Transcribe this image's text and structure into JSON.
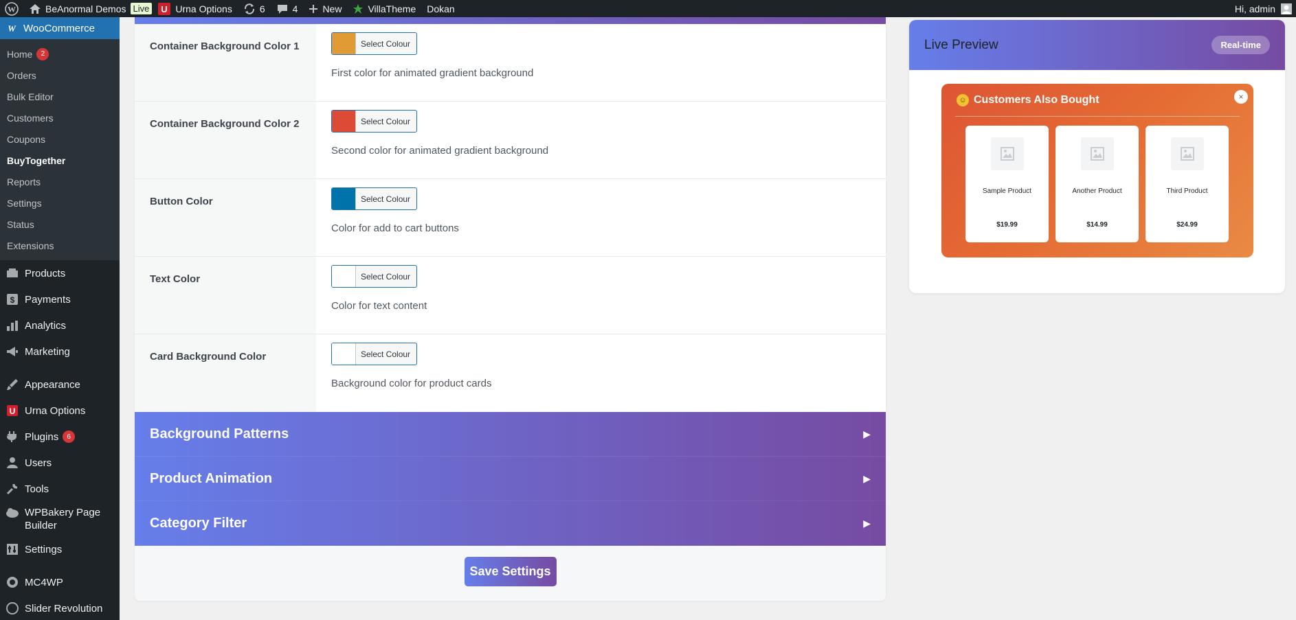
{
  "adminbar": {
    "site_name": "BeAnormal Demos",
    "live_label": "Live",
    "theme_options": "Urna Options",
    "updates_count": "6",
    "comments_count": "4",
    "new_label": "New",
    "villatheme": "VillaTheme",
    "dokan": "Dokan",
    "greeting": "Hi, admin"
  },
  "sidebar": {
    "woo_label": "WooCommerce",
    "submenu": [
      {
        "label": "Home",
        "badge": "2"
      },
      {
        "label": "Orders"
      },
      {
        "label": "Bulk Editor"
      },
      {
        "label": "Customers"
      },
      {
        "label": "Coupons"
      },
      {
        "label": "BuyTogether"
      },
      {
        "label": "Reports"
      },
      {
        "label": "Settings"
      },
      {
        "label": "Status"
      },
      {
        "label": "Extensions"
      }
    ],
    "menu": [
      {
        "label": "Products",
        "icon": "products-icon"
      },
      {
        "label": "Payments",
        "icon": "payments-icon"
      },
      {
        "label": "Analytics",
        "icon": "analytics-icon"
      },
      {
        "label": "Marketing",
        "icon": "marketing-icon"
      },
      {
        "label": "Appearance",
        "icon": "appearance-icon"
      },
      {
        "label": "Urna Options",
        "icon": "urna-icon"
      },
      {
        "label": "Plugins",
        "icon": "plugins-icon",
        "badge": "6"
      },
      {
        "label": "Users",
        "icon": "users-icon"
      },
      {
        "label": "Tools",
        "icon": "tools-icon"
      },
      {
        "label": "WPBakery Page Builder",
        "icon": "wpbakery-icon"
      },
      {
        "label": "Settings",
        "icon": "settings-icon"
      },
      {
        "label": "MC4WP",
        "icon": "mc4wp-icon"
      },
      {
        "label": "Slider Revolution",
        "icon": "slider-icon"
      }
    ]
  },
  "settings": {
    "rows": [
      {
        "label": "Container Background Color 1",
        "button": "Select Colour",
        "color": "#e09b35",
        "desc": "First color for animated gradient background"
      },
      {
        "label": "Container Background Color 2",
        "button": "Select Colour",
        "color": "#dd4a35",
        "desc": "Second color for animated gradient background"
      },
      {
        "label": "Button Color",
        "button": "Select Colour",
        "color": "#0073aa",
        "desc": "Color for add to cart buttons"
      },
      {
        "label": "Text Color",
        "button": "Select Colour",
        "color": "#ffffff",
        "desc": "Color for text content"
      },
      {
        "label": "Card Background Color",
        "button": "Select Colour",
        "color": "#ffffff",
        "desc": "Background color for product cards"
      }
    ],
    "sections": [
      {
        "title": "Background Patterns",
        "arrow": "▶"
      },
      {
        "title": "Product Animation",
        "arrow": "▶"
      },
      {
        "title": "Category Filter",
        "arrow": "▶"
      }
    ],
    "save_label": "Save Settings"
  },
  "preview": {
    "title": "Live Preview",
    "badge": "Real-time",
    "popup_title": "Customers Also Bought",
    "close": "×",
    "products": [
      {
        "name": "Sample Product",
        "price": "$19.99"
      },
      {
        "name": "Another Product",
        "price": "$14.99"
      },
      {
        "name": "Third Product",
        "price": "$24.99"
      }
    ]
  },
  "colors": {
    "accent_start": "#667eea",
    "accent_end": "#764ba2",
    "admin_blue": "#2271b1",
    "admin_dark": "#1d2327",
    "badge_red": "#d63638"
  }
}
